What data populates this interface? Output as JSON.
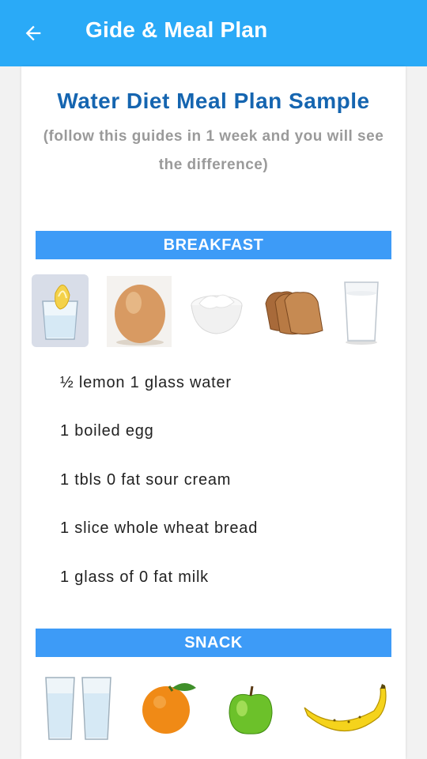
{
  "appbar": {
    "title": "Gide & Meal Plan",
    "back_icon": "arrow-left-icon",
    "color": "#2aaaf7"
  },
  "header": {
    "title": "Water Diet Meal Plan Sample",
    "subtitle": "(follow this guides in 1 week and you will see the difference)"
  },
  "breakfast": {
    "label": "BREAKFAST",
    "images": [
      "lemon-water-glass",
      "boiled-egg",
      "sour-cream-bowl",
      "wheat-bread-slices",
      "milk-glass"
    ],
    "items": [
      "½ lemon 1 glass water",
      "1 boiled egg",
      "1 tbls 0 fat sour cream",
      "1 slice whole wheat bread",
      "1 glass of 0 fat milk"
    ]
  },
  "snack": {
    "label": "SNACK",
    "images": [
      "two-water-glasses",
      "orange",
      "green-apple",
      "banana"
    ]
  },
  "colors": {
    "section_bar": "#3d9bf7",
    "title": "#1565b0",
    "subtitle": "#9a9a9a"
  }
}
